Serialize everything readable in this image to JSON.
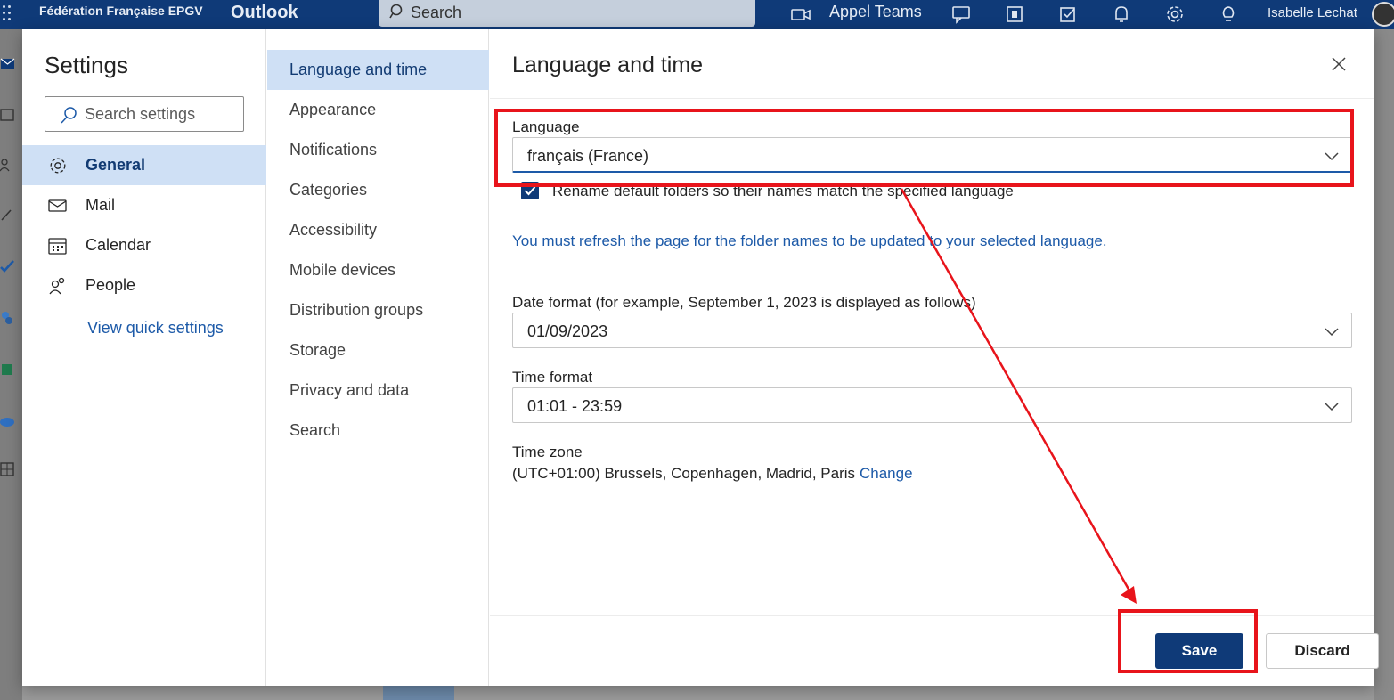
{
  "topbar": {
    "org_name": "Fédération Française EPGV",
    "app_name": "Outlook",
    "search_label": "Search",
    "teams_label": "Appel Teams",
    "user_name": "Isabelle Lechat",
    "icons": [
      "waffle-icon",
      "teams-call-icon",
      "chat-icon",
      "office-icon",
      "tasks-icon",
      "bell-icon",
      "gear-icon",
      "lightbulb-icon"
    ]
  },
  "rail": {
    "icons": [
      "mail-icon",
      "calendar-icon",
      "people-icon",
      "attach-icon",
      "todo-icon",
      "apps-icon",
      "sheets-icon",
      "cloud-icon",
      "grid-icon"
    ]
  },
  "settings": {
    "title": "Settings",
    "search_placeholder": "Search settings",
    "categories": [
      {
        "label": "General",
        "icon": "gear-icon",
        "active": true
      },
      {
        "label": "Mail",
        "icon": "mail-icon",
        "active": false
      },
      {
        "label": "Calendar",
        "icon": "calendar-icon",
        "active": false
      },
      {
        "label": "People",
        "icon": "people-icon",
        "active": false
      }
    ],
    "view_quick_settings": "View quick settings",
    "subcategories": [
      {
        "label": "Language and time",
        "active": true
      },
      {
        "label": "Appearance",
        "active": false
      },
      {
        "label": "Notifications",
        "active": false
      },
      {
        "label": "Categories",
        "active": false
      },
      {
        "label": "Accessibility",
        "active": false
      },
      {
        "label": "Mobile devices",
        "active": false
      },
      {
        "label": "Distribution groups",
        "active": false
      },
      {
        "label": "Storage",
        "active": false
      },
      {
        "label": "Privacy and data",
        "active": false
      },
      {
        "label": "Search",
        "active": false
      }
    ]
  },
  "pane": {
    "title": "Language and time",
    "language_label": "Language",
    "language_value": "français (France)",
    "rename_checked": true,
    "rename_label": "Rename default folders so their names match the specified language",
    "refresh_note": "You must refresh the page for the folder names to be updated to your selected language.",
    "date_format_label": "Date format (for example, September 1, 2023 is displayed as follows)",
    "date_format_value": "01/09/2023",
    "time_format_label": "Time format",
    "time_format_value": "01:01 - 23:59",
    "time_zone_label": "Time zone",
    "time_zone_value": "(UTC+01:00) Brussels, Copenhagen, Madrid, Paris",
    "time_zone_change": "Change",
    "save_label": "Save",
    "discard_label": "Discard"
  },
  "colors": {
    "brand": "#0f3a78",
    "accent_link": "#1d5aa8",
    "selected_bg": "#cfe0f5",
    "annotation": "#e8141b"
  }
}
